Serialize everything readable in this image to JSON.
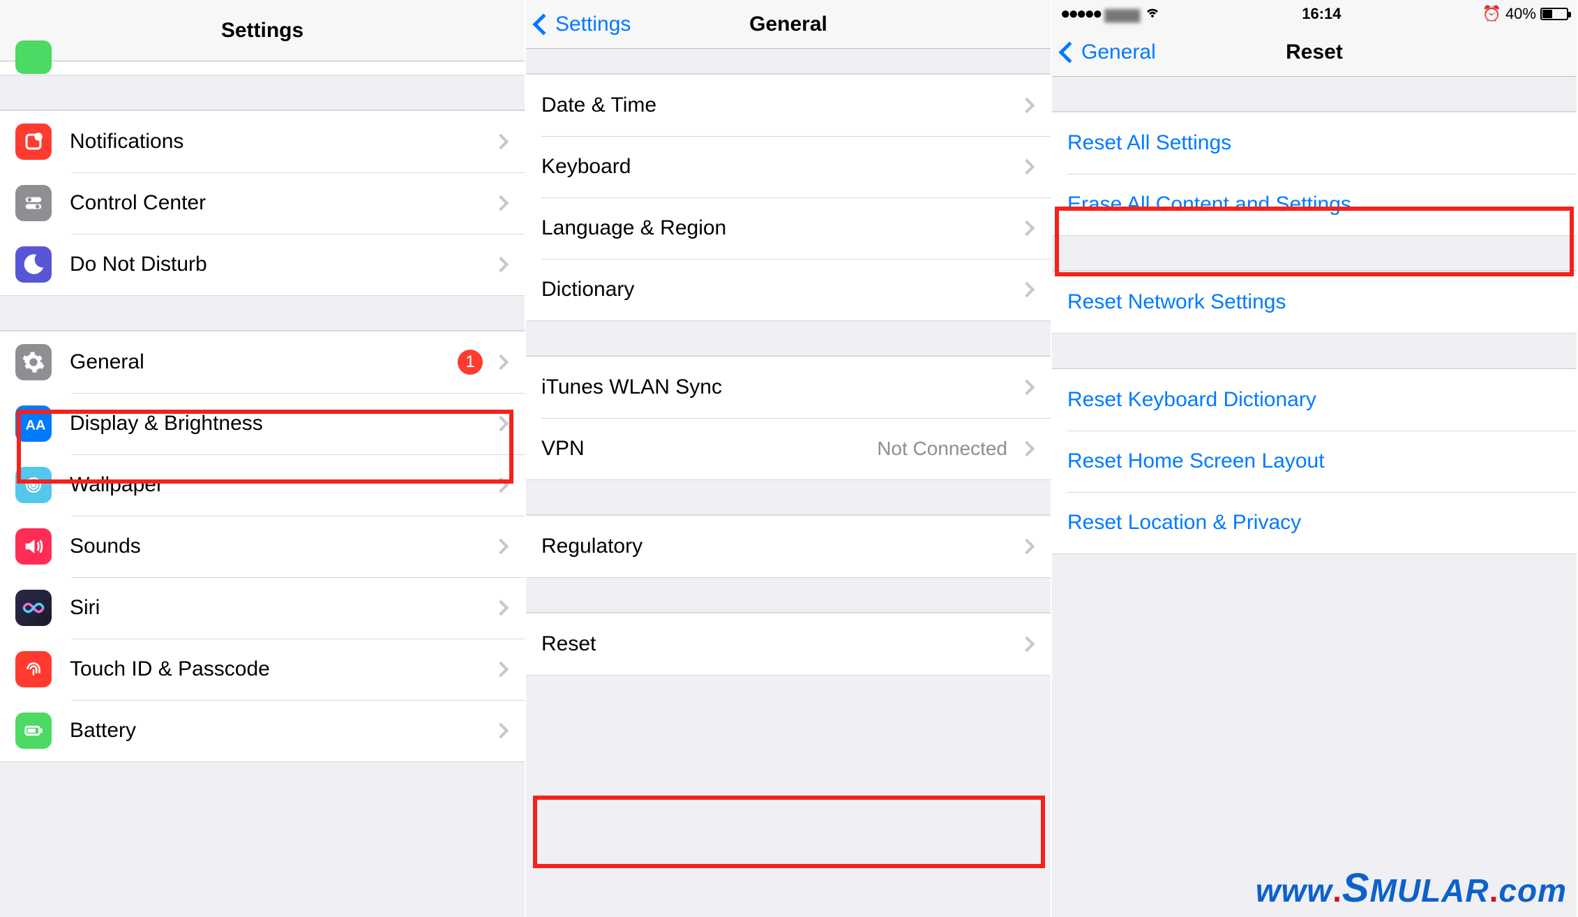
{
  "panel1": {
    "title": "Settings",
    "group1": [
      {
        "label": "Notifications",
        "icon": "notifications-icon",
        "color": "#ff3b30"
      },
      {
        "label": "Control Center",
        "icon": "control-center-icon",
        "color": "#8e8e93"
      },
      {
        "label": "Do Not Disturb",
        "icon": "dnd-icon",
        "color": "#5856d6"
      }
    ],
    "group2": [
      {
        "label": "General",
        "icon": "gear-icon",
        "color": "#8e8e93",
        "badge": "1"
      },
      {
        "label": "Display & Brightness",
        "icon": "display-icon",
        "color": "#007aff"
      },
      {
        "label": "Wallpaper",
        "icon": "wallpaper-icon",
        "color": "#54c7ec"
      },
      {
        "label": "Sounds",
        "icon": "sounds-icon",
        "color": "#ff2d55"
      },
      {
        "label": "Siri",
        "icon": "siri-icon",
        "color": "#000"
      },
      {
        "label": "Touch ID & Passcode",
        "icon": "touchid-icon",
        "color": "#ff3b30"
      },
      {
        "label": "Battery",
        "icon": "battery-icon",
        "color": "#4cd964"
      }
    ]
  },
  "panel2": {
    "back": "Settings",
    "title": "General",
    "g1": [
      {
        "label": "Date & Time"
      },
      {
        "label": "Keyboard"
      },
      {
        "label": "Language & Region"
      },
      {
        "label": "Dictionary"
      }
    ],
    "g2": [
      {
        "label": "iTunes WLAN Sync"
      },
      {
        "label": "VPN",
        "detail": "Not Connected"
      }
    ],
    "g3": [
      {
        "label": "Regulatory"
      }
    ],
    "g4": [
      {
        "label": "Reset"
      }
    ]
  },
  "panel3": {
    "status": {
      "time": "16:14",
      "battery": "40%"
    },
    "back": "General",
    "title": "Reset",
    "g1": [
      {
        "label": "Reset All Settings"
      },
      {
        "label": "Erase All Content and Settings"
      }
    ],
    "g2": [
      {
        "label": "Reset Network Settings"
      }
    ],
    "g3": [
      {
        "label": "Reset Keyboard Dictionary"
      },
      {
        "label": "Reset Home Screen Layout"
      },
      {
        "label": "Reset Location & Privacy"
      }
    ]
  },
  "watermark": "www.Smular.com"
}
